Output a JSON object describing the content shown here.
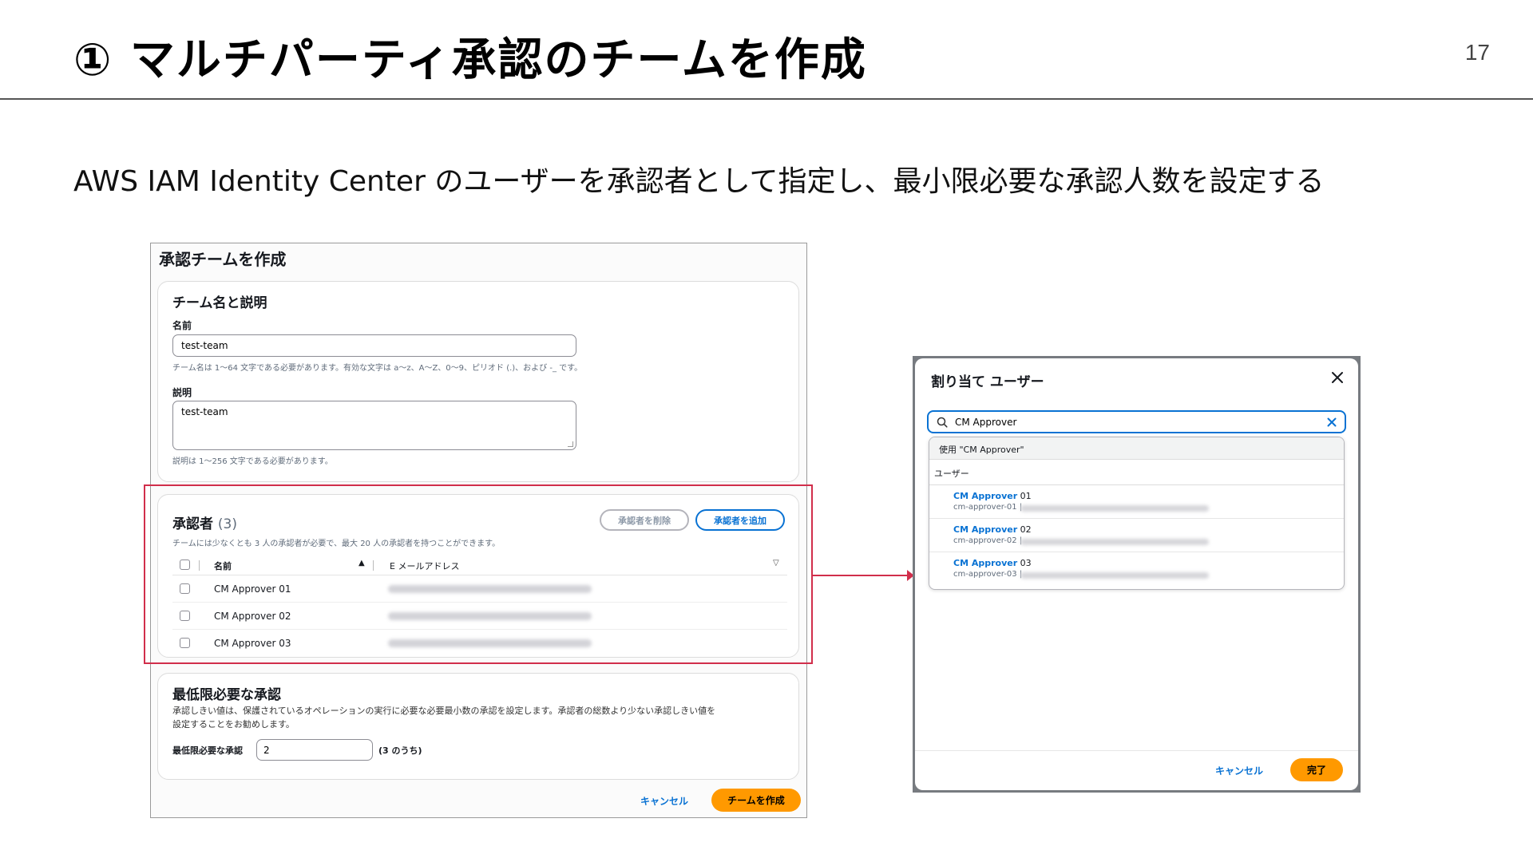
{
  "slide": {
    "title": "① マルチパーティ承認のチームを作成",
    "page_number": "17",
    "subtitle": "AWS IAM Identity Center のユーザーを承認者として指定し、最小限必要な承認人数を設定する"
  },
  "create_team": {
    "heading": "承認チームを作成",
    "team_section": {
      "title": "チーム名と説明",
      "name_label": "名前",
      "name_value": "test-team",
      "name_hint": "チーム名は 1〜64 文字である必要があります。有効な文字は a〜z、A〜Z、0〜9、ピリオド (.)、および -_ です。",
      "description_label": "説明",
      "description_value": "test-team",
      "description_hint": "説明は 1〜256 文字である必要があります。"
    },
    "approvers_section": {
      "title": "承認者",
      "count": "(3)",
      "remove_button": "承認者を削除",
      "add_button": "承認者を追加",
      "hint": "チームには少なくとも 3 人の承認者が必要で、最大 20 人の承認者を持つことができます。",
      "columns": [
        "名前",
        "E メールアドレス"
      ],
      "rows": [
        {
          "name": "CM Approver 01"
        },
        {
          "name": "CM Approver 02"
        },
        {
          "name": "CM Approver 03"
        }
      ]
    },
    "threshold_section": {
      "title": "最低限必要な承認",
      "description_line1": "承認しきい値は、保護されているオペレーションの実行に必要な必要最小数の承認を設定します。承認者の総数より少ない承認しきい値を",
      "description_line2": "設定することをお勧めします。",
      "field_label": "最低限必要な承認",
      "field_value": "2",
      "of_total": "(3 のうち)"
    },
    "cancel_button": "キャンセル",
    "create_button": "チームを作成"
  },
  "assign_modal": {
    "title": "割り当て ユーザー",
    "search_value": "CM Approver",
    "use_option": "使用 \"CM Approver\"",
    "group_label": "ユーザー",
    "users": [
      {
        "name_bold": "CM Approver",
        "name_rest": " 01",
        "email_prefix": "cm-approver-01 |"
      },
      {
        "name_bold": "CM Approver",
        "name_rest": " 02",
        "email_prefix": "cm-approver-02 |"
      },
      {
        "name_bold": "CM Approver",
        "name_rest": " 03",
        "email_prefix": "cm-approver-03 |"
      }
    ],
    "cancel_button": "キャンセル",
    "done_button": "完了"
  },
  "colors": {
    "accent_blue": "#0972d3",
    "primary_orange": "#ff9900",
    "highlight_red": "#d12e4b"
  },
  "icons": [
    "search-icon",
    "close-icon",
    "clear-search-icon",
    "sort-ascending-icon",
    "sort-descending-icon",
    "arrow-icon"
  ]
}
